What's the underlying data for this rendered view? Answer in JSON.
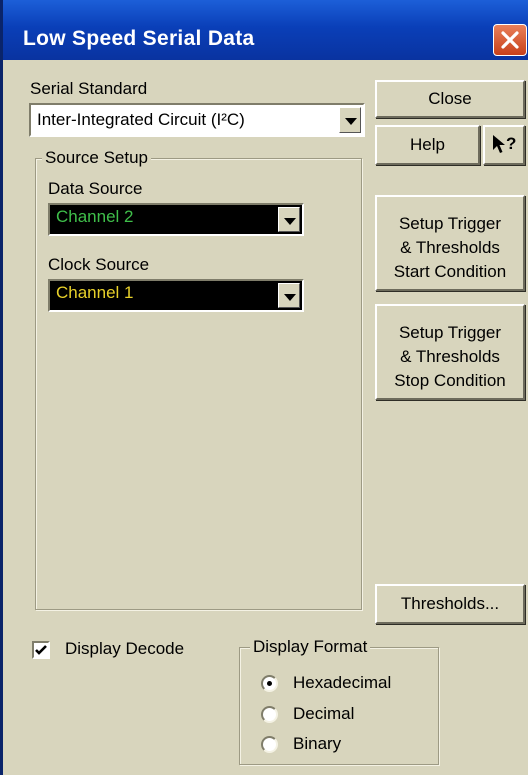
{
  "window": {
    "title": "Low Speed Serial Data",
    "close_icon": "close-x-icon"
  },
  "serial_standard": {
    "label": "Serial Standard",
    "value": "Inter-Integrated Circuit (I²C)"
  },
  "source_setup": {
    "legend": "Source Setup",
    "data_source": {
      "label": "Data Source",
      "value": "Channel 2",
      "color": "#3fbf4a"
    },
    "clock_source": {
      "label": "Clock Source",
      "value": "Channel 1",
      "color": "#e8d12a"
    }
  },
  "buttons": {
    "close": "Close",
    "help": "Help",
    "context_help": "↖?",
    "setup_start": [
      "Setup Trigger",
      "& Thresholds",
      "Start Condition"
    ],
    "setup_stop": [
      "Setup Trigger",
      "& Thresholds",
      "Stop Condition"
    ],
    "thresholds": "Thresholds..."
  },
  "display_decode": {
    "label": "Display Decode",
    "checked": true
  },
  "display_format": {
    "legend": "Display Format",
    "options": [
      "Hexadecimal",
      "Decimal",
      "Binary"
    ],
    "selected": "Hexadecimal"
  }
}
